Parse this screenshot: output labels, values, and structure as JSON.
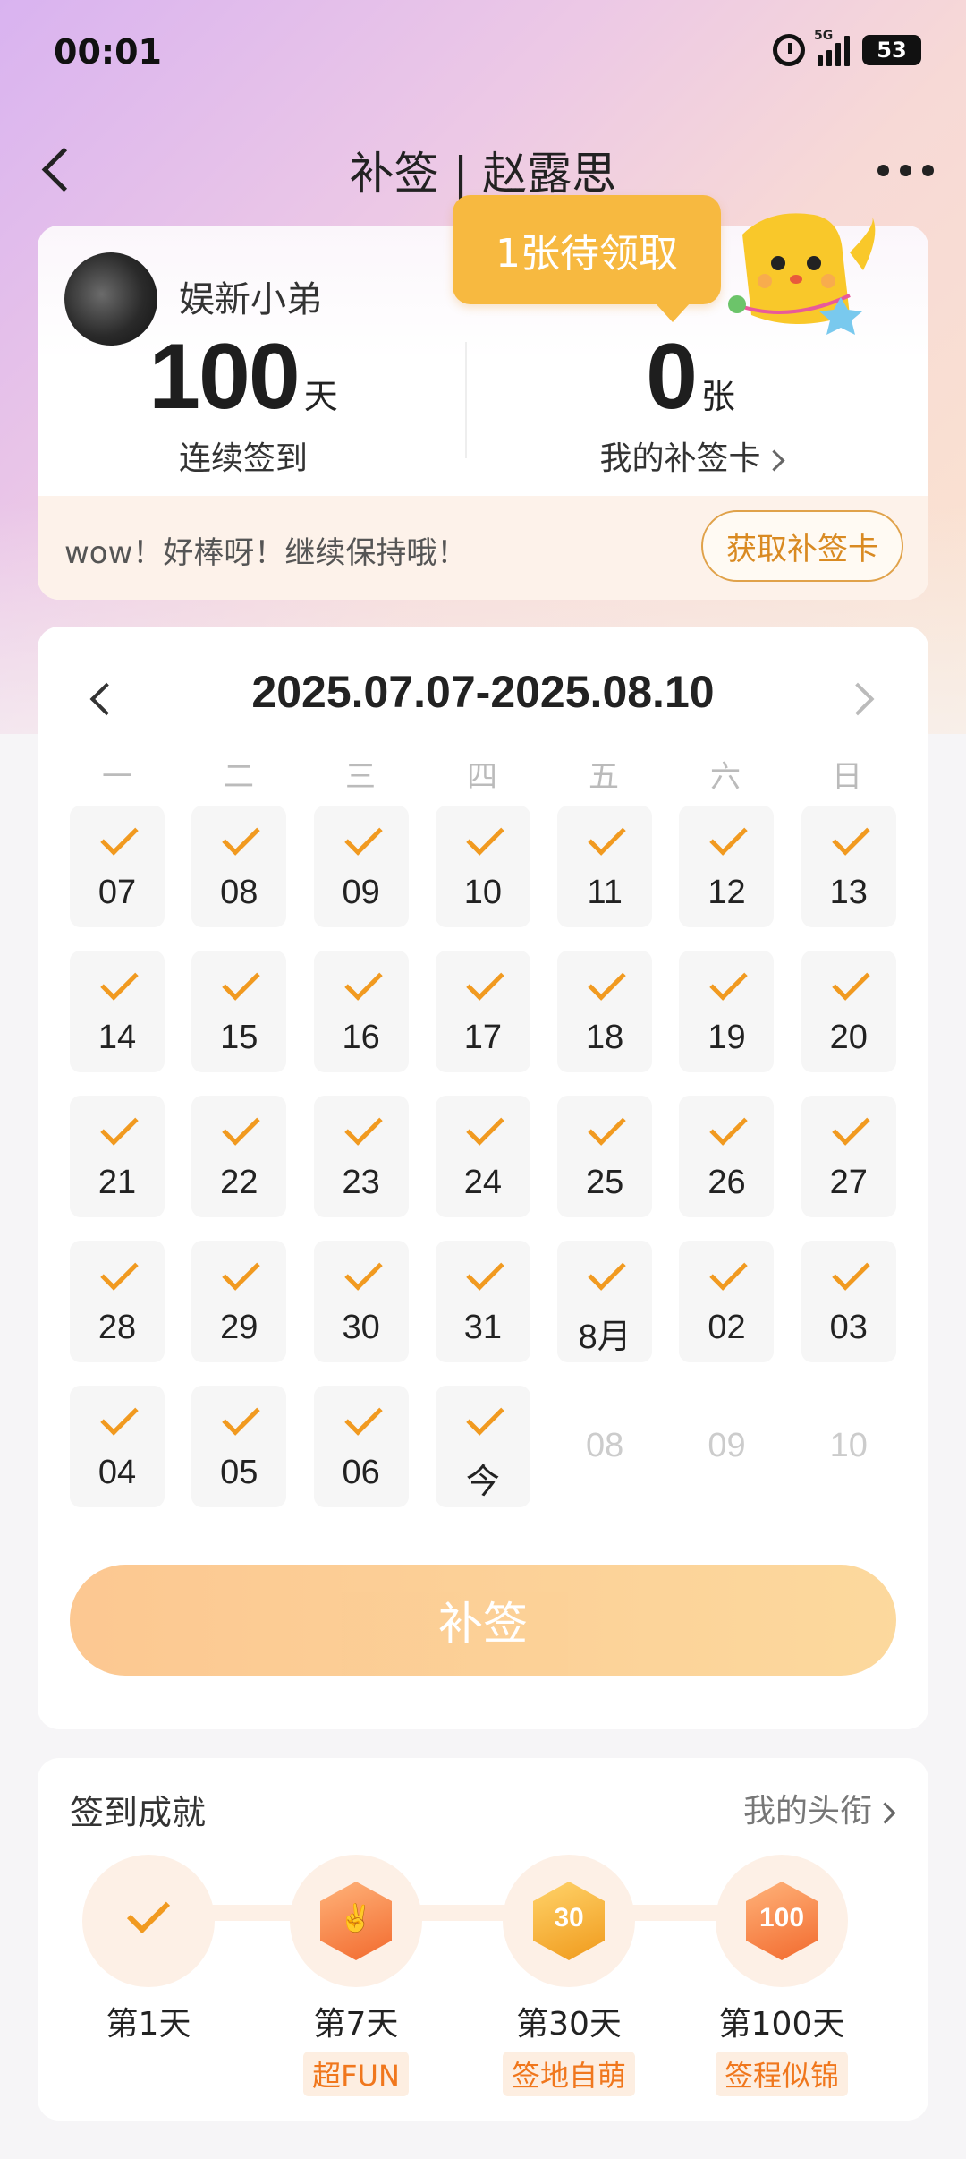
{
  "status_bar": {
    "time": "00:01",
    "network": "5G",
    "battery": "53"
  },
  "nav": {
    "title": "补签 | 赵露思"
  },
  "summary": {
    "username": "娱新小弟",
    "streak_value": "100",
    "streak_unit": "天",
    "streak_label": "连续签到",
    "cards_value": "0",
    "cards_unit": "张",
    "cards_label": "我的补签卡",
    "tooltip": "1张待领取",
    "encourage": "wow！好棒呀！继续保持哦！",
    "get_card_button": "获取补签卡"
  },
  "calendar": {
    "range": "2025.07.07-2025.08.10",
    "weekdays": [
      "一",
      "二",
      "三",
      "四",
      "五",
      "六",
      "日"
    ],
    "days": [
      {
        "label": "07",
        "checked": true
      },
      {
        "label": "08",
        "checked": true
      },
      {
        "label": "09",
        "checked": true
      },
      {
        "label": "10",
        "checked": true
      },
      {
        "label": "11",
        "checked": true
      },
      {
        "label": "12",
        "checked": true
      },
      {
        "label": "13",
        "checked": true
      },
      {
        "label": "14",
        "checked": true
      },
      {
        "label": "15",
        "checked": true
      },
      {
        "label": "16",
        "checked": true
      },
      {
        "label": "17",
        "checked": true
      },
      {
        "label": "18",
        "checked": true
      },
      {
        "label": "19",
        "checked": true
      },
      {
        "label": "20",
        "checked": true
      },
      {
        "label": "21",
        "checked": true
      },
      {
        "label": "22",
        "checked": true
      },
      {
        "label": "23",
        "checked": true
      },
      {
        "label": "24",
        "checked": true
      },
      {
        "label": "25",
        "checked": true
      },
      {
        "label": "26",
        "checked": true
      },
      {
        "label": "27",
        "checked": true
      },
      {
        "label": "28",
        "checked": true
      },
      {
        "label": "29",
        "checked": true
      },
      {
        "label": "30",
        "checked": true
      },
      {
        "label": "31",
        "checked": true
      },
      {
        "label": "8月",
        "checked": true
      },
      {
        "label": "02",
        "checked": true
      },
      {
        "label": "03",
        "checked": true
      },
      {
        "label": "04",
        "checked": true
      },
      {
        "label": "05",
        "checked": true
      },
      {
        "label": "06",
        "checked": true
      },
      {
        "label": "今",
        "checked": true
      },
      {
        "label": "08",
        "checked": false
      },
      {
        "label": "09",
        "checked": false
      },
      {
        "label": "10",
        "checked": false
      }
    ],
    "makeup_button": "补签"
  },
  "achievements": {
    "title": "签到成就",
    "link": "我的头衔",
    "items": [
      {
        "day": "第1天",
        "tag": "",
        "badge_text": ""
      },
      {
        "day": "第7天",
        "tag": "超FUN",
        "badge_text": ""
      },
      {
        "day": "第30天",
        "tag": "签地自萌",
        "badge_text": "30"
      },
      {
        "day": "第100天",
        "tag": "签程似锦",
        "badge_text": "100"
      }
    ]
  },
  "colors": {
    "accent": "#f19a20",
    "tooltip": "#f7b940",
    "tag_text": "#f0771d"
  }
}
